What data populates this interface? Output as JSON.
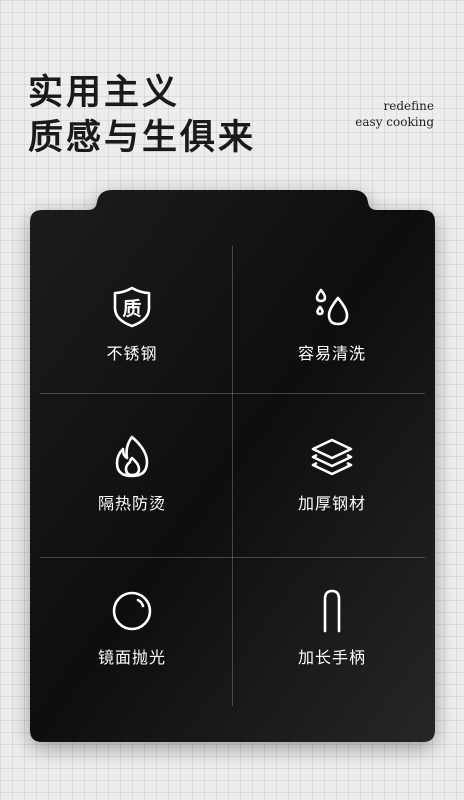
{
  "headline": {
    "line1": "实用主义",
    "line2": "质感与生俱来"
  },
  "tagline": {
    "line1": "redefine",
    "line2": "easy cooking"
  },
  "features": [
    {
      "label": "不锈钢",
      "icon": "quality-shield-icon",
      "icon_text": "质"
    },
    {
      "label": "容易清洗",
      "icon": "water-drops-icon"
    },
    {
      "label": "隔热防烫",
      "icon": "flame-icon"
    },
    {
      "label": "加厚钢材",
      "icon": "layers-icon"
    },
    {
      "label": "镜面抛光",
      "icon": "mirror-circle-icon"
    },
    {
      "label": "加长手柄",
      "icon": "handle-icon"
    }
  ],
  "colors": {
    "panel": "#151515",
    "text": "#ffffff",
    "background": "#ededed"
  }
}
